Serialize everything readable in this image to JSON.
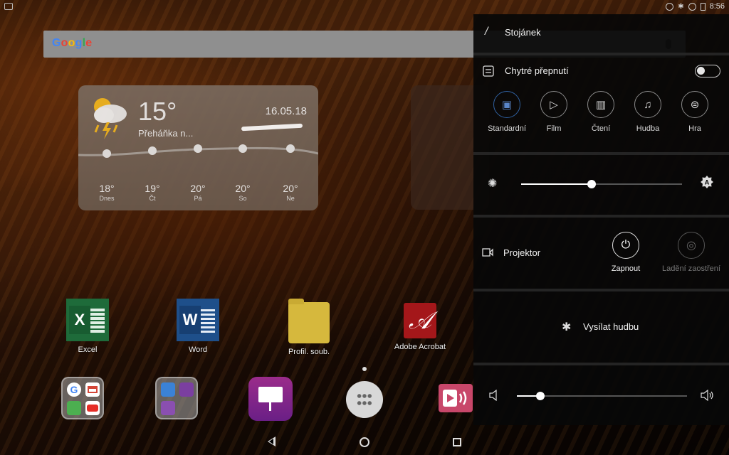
{
  "status_bar": {
    "time": "8:56"
  },
  "search": {
    "logo": "Google"
  },
  "weather": {
    "temperature": "15°",
    "condition": "Přeháňka n...",
    "date": "16.05.18",
    "forecast": [
      {
        "temp": "18°",
        "day": "Dnes"
      },
      {
        "temp": "19°",
        "day": "Čt"
      },
      {
        "temp": "20°",
        "day": "Pá"
      },
      {
        "temp": "20°",
        "day": "So"
      },
      {
        "temp": "20°",
        "day": "Ne"
      }
    ]
  },
  "apps": {
    "excel": "Excel",
    "word": "Word",
    "files": "Profil. soub.",
    "acrobat": "Adobe Acrobat"
  },
  "panel": {
    "stand_label": "Stojánek",
    "smart_switch_label": "Chytré přepnutí",
    "modes": [
      "Standardní",
      "Film",
      "Čtení",
      "Hudba",
      "Hra"
    ],
    "brightness_level": 0.44,
    "projector_label": "Projektor",
    "power_label": "Zapnout",
    "focus_label": "Ladění zaostření",
    "broadcast_label": "Vysílat hudbu",
    "volume_level": 0.14
  }
}
